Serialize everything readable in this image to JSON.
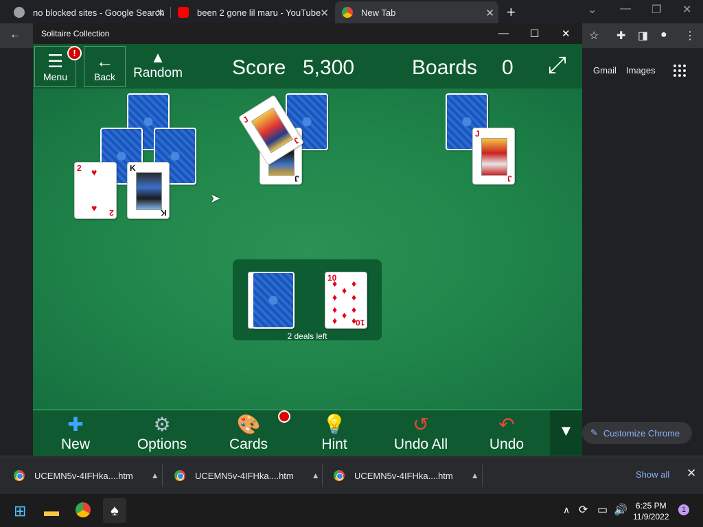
{
  "browser": {
    "tabs": [
      {
        "title": "no blocked sites - Google Search"
      },
      {
        "title": "been 2 gone lil maru - YouTube"
      },
      {
        "title": "New Tab"
      }
    ],
    "links": {
      "gmail": "Gmail",
      "images": "Images"
    },
    "customize_label": "Customize Chrome"
  },
  "solitaire": {
    "window_title": "Solitaire Collection",
    "header": {
      "menu_label": "Menu",
      "alert_mark": "!",
      "back_label": "Back",
      "mode_label": "Random",
      "score_label": "Score",
      "score_value": "5,300",
      "boards_label": "Boards",
      "boards_value": "0"
    },
    "cards": {
      "two_hearts": {
        "rank": "2",
        "suit": "♥"
      },
      "king_spades": {
        "rank": "K",
        "suit": "♠"
      },
      "jack_diamonds_tilted": {
        "rank": "J",
        "suit": "♦"
      },
      "jack_spades": {
        "rank": "J",
        "suit": "♠"
      },
      "jack_hearts": {
        "rank": "J",
        "suit": "♥"
      },
      "ten_diamonds": {
        "rank": "10",
        "suit": "♦"
      }
    },
    "stock": {
      "deals_left": "2 deals left"
    },
    "toolbar": {
      "new": "New",
      "options": "Options",
      "cards": "Cards",
      "hint": "Hint",
      "undo_all": "Undo All",
      "undo": "Undo"
    }
  },
  "downloads": {
    "items": [
      {
        "name": "UCEMN5v-4IFHka....htm"
      },
      {
        "name": "UCEMN5v-4IFHka....htm"
      },
      {
        "name": "UCEMN5v-4IFHka....htm"
      }
    ],
    "show_all": "Show all"
  },
  "taskbar": {
    "time": "6:25 PM",
    "date": "11/9/2022",
    "notification_count": "1"
  },
  "colors": {
    "felt": "#1f8449",
    "header": "#0f5a31",
    "card_back": "#1f5fc6",
    "red_suit": "#e2001a"
  }
}
